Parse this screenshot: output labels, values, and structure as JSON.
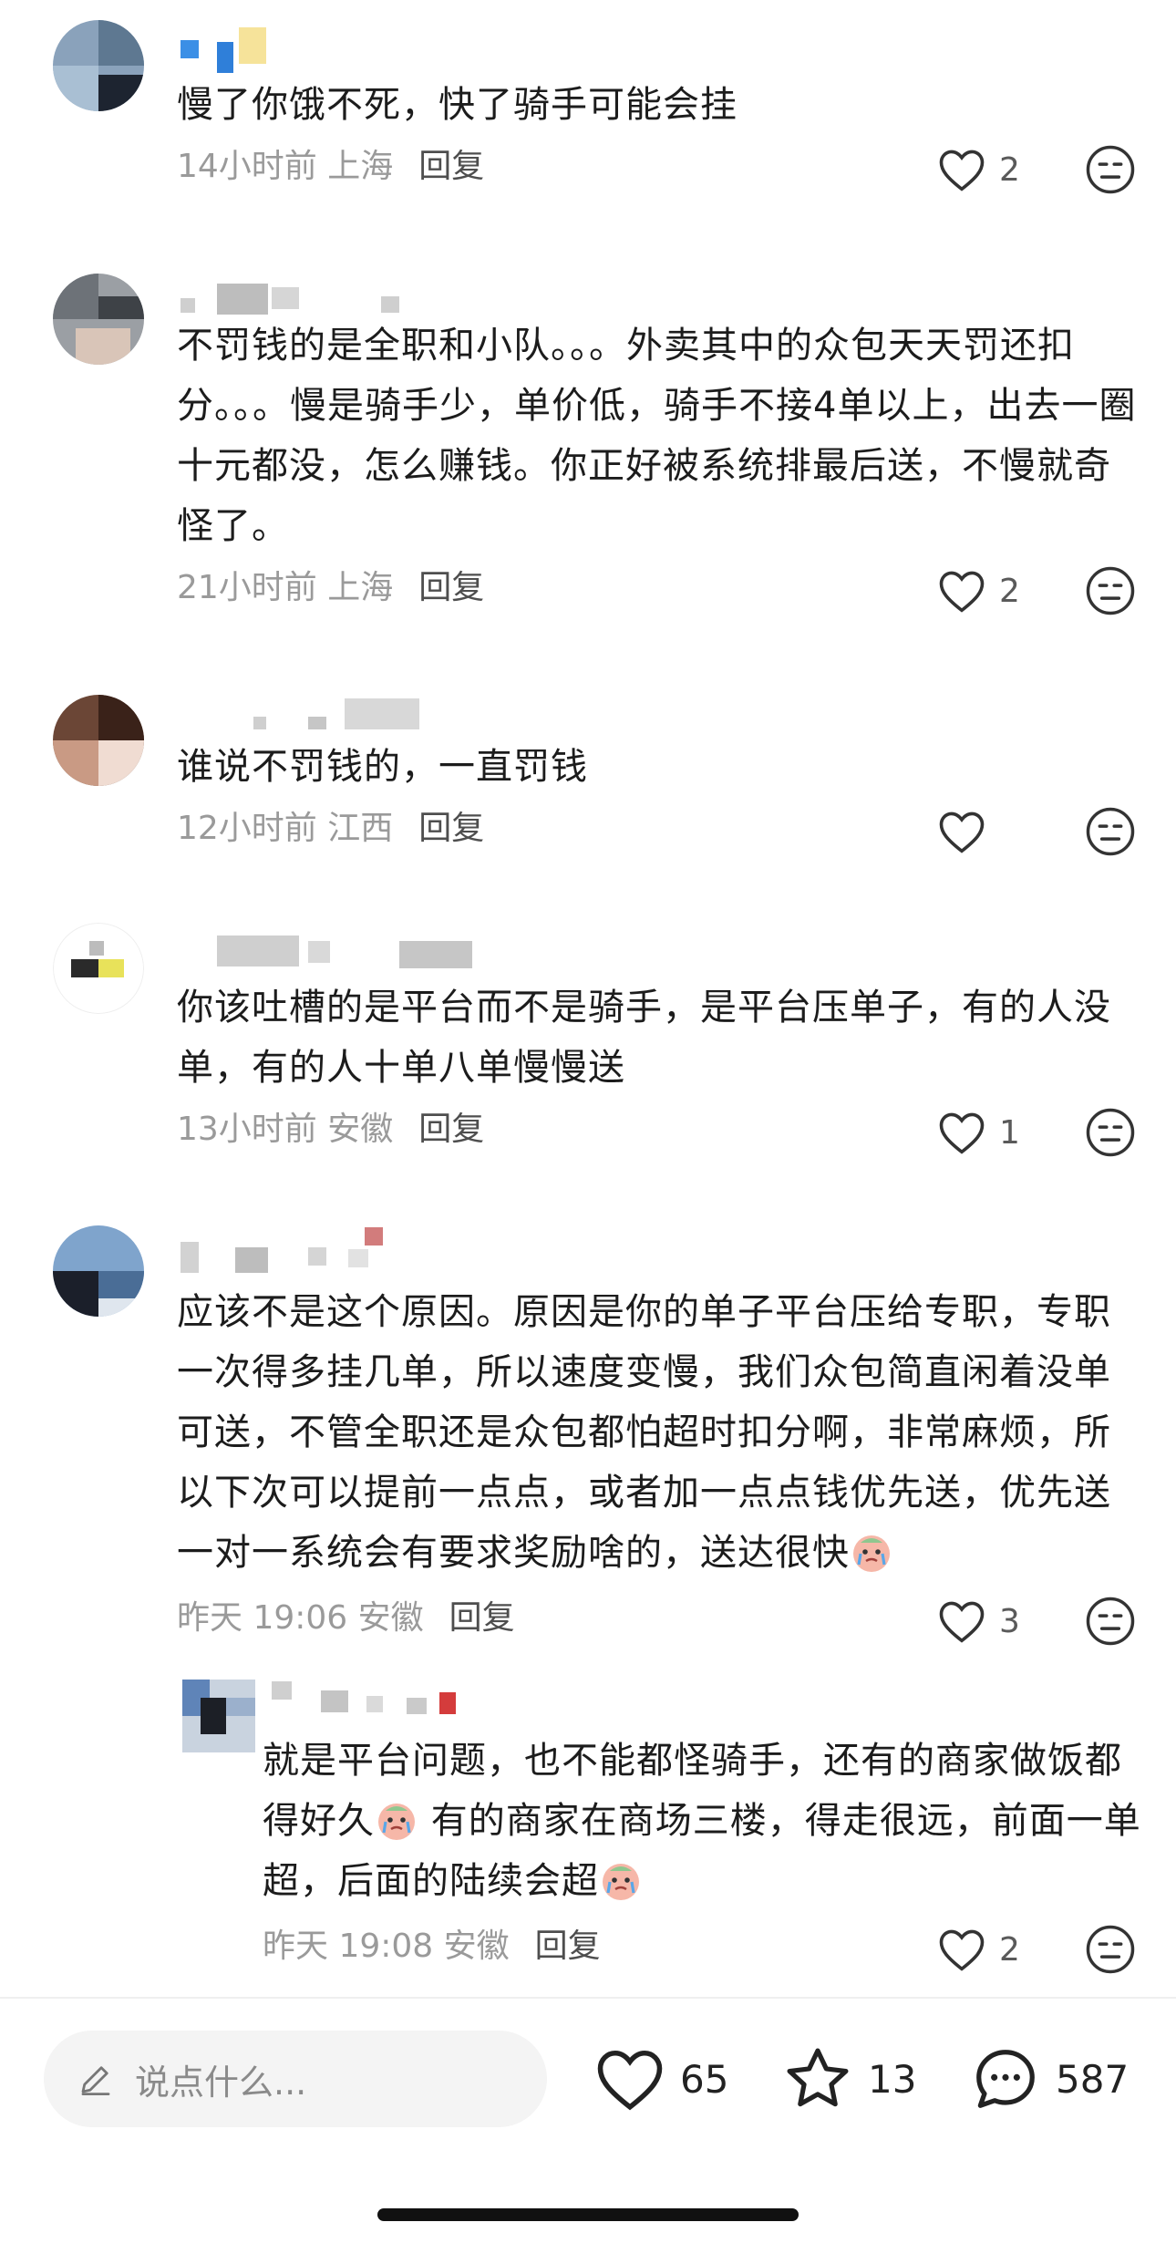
{
  "comments": [
    {
      "text": "慢了你饿不死，快了骑手可能会挂",
      "time": "14小时前 上海",
      "reply": "回复",
      "likes": "2"
    },
    {
      "text": "不罚钱的是全职和小队。。。外卖其中的众包天天罚还扣分。。。慢是骑手少，单价低，骑手不接4单以上，出去一圈十元都没，怎么赚钱。你正好被系统排最后送，不慢就奇怪了。",
      "time": "21小时前 上海",
      "reply": "回复",
      "likes": "2"
    },
    {
      "text": "谁说不罚钱的，一直罚钱",
      "time": "12小时前 江西",
      "reply": "回复",
      "likes": ""
    },
    {
      "text": "你该吐槽的是平台而不是骑手，是平台压单子，有的人没单，有的人十单八单慢慢送",
      "time": "13小时前 安徽",
      "reply": "回复",
      "likes": "1"
    },
    {
      "text": "应该不是这个原因。原因是你的单子平台压给专职，专职一次得多挂几单，所以速度变慢，我们众包简直闲着没单可送，不管全职还是众包都怕超时扣分啊，非常麻烦，所以下次可以提前一点点，或者加一点点钱优先送，优先送一对一系统会有要求奖励啥的，送达很快",
      "time": "昨天 19:06 安徽",
      "reply": "回复",
      "likes": "3",
      "emoji": "crying-face"
    }
  ],
  "sub_reply": {
    "text_part1": "就是平台问题，也不能都怪骑手，还有的商家做饭都得好久",
    "text_part2": " 有的商家在商场三楼，得走很远，前面一单超，后面的陆续会超",
    "time": "昨天 19:08 安徽",
    "reply": "回复",
    "likes": "2",
    "emoji": "crying-face"
  },
  "bottom_bar": {
    "input_placeholder": "说点什么...",
    "like_count": "65",
    "star_count": "13",
    "comment_count": "587"
  }
}
